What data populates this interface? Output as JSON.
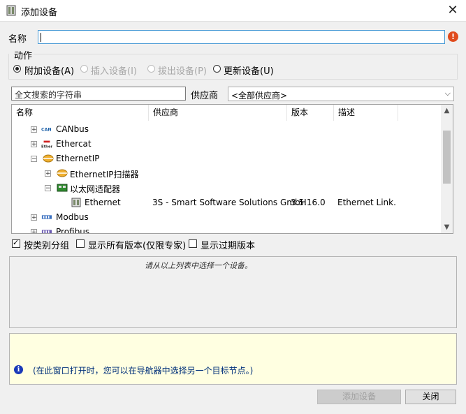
{
  "window": {
    "title": "添加设备",
    "close_glyph": "✕"
  },
  "name_field": {
    "label": "名称",
    "value": "",
    "error_glyph": "!"
  },
  "action_group": {
    "label": "动作",
    "options": [
      {
        "label": "附加设备(A)",
        "selected": true,
        "enabled": true
      },
      {
        "label": "插入设备(I)",
        "selected": false,
        "enabled": false
      },
      {
        "label": "拔出设备(P)",
        "selected": false,
        "enabled": false
      },
      {
        "label": "更新设备(U)",
        "selected": false,
        "enabled": true
      }
    ]
  },
  "search": {
    "placeholder": "全文搜索的字符串"
  },
  "vendor": {
    "label": "供应商",
    "selected": "<全部供应商>"
  },
  "tree": {
    "columns": [
      "名称",
      "供应商",
      "版本",
      "描述"
    ],
    "rows": [
      {
        "expander": "+",
        "icon": "can-icon",
        "name": "CANbus",
        "vendor": "",
        "version": "",
        "description": ""
      },
      {
        "expander": "+",
        "icon": "ethercat-icon",
        "name": "Ethercat",
        "vendor": "",
        "version": "",
        "description": ""
      },
      {
        "expander": "−",
        "icon": "ethernetip-icon",
        "name": "EthernetIP",
        "vendor": "",
        "version": "",
        "description": ""
      },
      {
        "expander": "+",
        "icon": "ethernetip-icon",
        "name": "EthernetIP扫描器",
        "vendor": "",
        "version": "",
        "description": ""
      },
      {
        "expander": "−",
        "icon": "ethernet-adapter-icon",
        "name": "以太网适配器",
        "vendor": "",
        "version": "",
        "description": ""
      },
      {
        "expander": "",
        "icon": "device-icon",
        "name": "Ethernet",
        "vendor": "3S - Smart Software Solutions GmbH",
        "version": "3.5.16.0",
        "description": "Ethernet Link."
      },
      {
        "expander": "+",
        "icon": "modbus-icon",
        "name": "Modbus",
        "vendor": "",
        "version": "",
        "description": ""
      },
      {
        "expander": "+",
        "icon": "profibus-icon",
        "name": "Profibus",
        "vendor": "",
        "version": "",
        "description": ""
      }
    ]
  },
  "options": {
    "group_by_category": {
      "label": "按类别分组",
      "checked": true
    },
    "show_all_versions": {
      "label": "显示所有版本(仅限专家)",
      "checked": false
    },
    "show_outdated": {
      "label": "显示过期版本",
      "checked": false
    }
  },
  "description_text": "请从以上列表中选择一个设备。",
  "info_text": "(在此窗口打开时，您可以在导航器中选择另一个目标节点。)",
  "info_glyph": "i",
  "buttons": {
    "add": "添加设备",
    "close": "关闭"
  },
  "colors": {
    "accent": "#4a9bd6",
    "error": "#e04a1c",
    "info_bg": "#ffffe1"
  }
}
